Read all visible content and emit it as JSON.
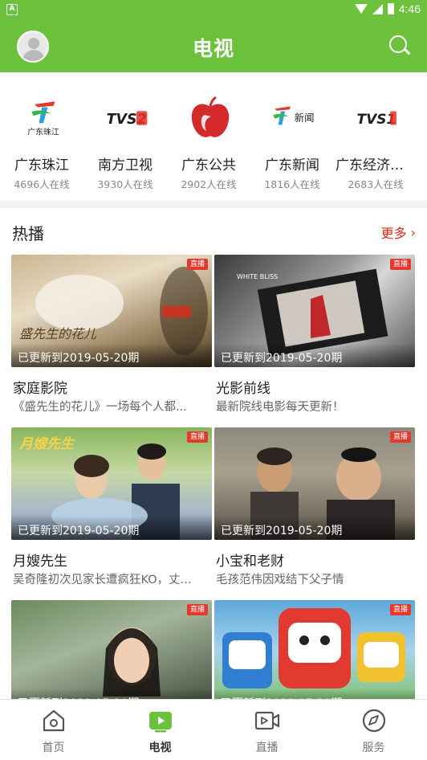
{
  "status_bar": {
    "time": "4:46",
    "left_icon": "A"
  },
  "header": {
    "title": "电视"
  },
  "channels": [
    {
      "name": "广东珠江",
      "viewers": "4696人在线",
      "logo_text": "广东珠江"
    },
    {
      "name": "南方卫视",
      "viewers": "3930人在线",
      "logo_text": "TVS2"
    },
    {
      "name": "广东公共",
      "viewers": "2902人在线",
      "logo_text": ""
    },
    {
      "name": "广东新闻",
      "viewers": "1816人在线",
      "logo_text": "新闻"
    },
    {
      "name": "广东经济科...",
      "viewers": "2683人在线",
      "logo_text": "TVS1"
    }
  ],
  "section": {
    "title": "热播",
    "more": "更多"
  },
  "programs": [
    {
      "title": "家庭影院",
      "desc": "《盛先生的花儿》一场每个人都...",
      "update": "已更新到2019-05-20期",
      "badge": "直播",
      "poster_text": "盛先生的花儿"
    },
    {
      "title": "光影前线",
      "desc": "最新院线电影每天更新！",
      "update": "已更新到2019-05-20期",
      "badge": "直播",
      "poster_text": "WHITE BLISS"
    },
    {
      "title": "月嫂先生",
      "desc": "吴奇隆初次见家长遭疯狂KO，丈...",
      "update": "已更新到2019-05-20期",
      "badge": "直播",
      "poster_text": "月嫂先生"
    },
    {
      "title": "小宝和老财",
      "desc": "毛孩范伟因戏结下父子情",
      "update": "已更新到2019-05-20期",
      "badge": "直播",
      "poster_text": ""
    },
    {
      "title": "",
      "desc": "",
      "update": "已更新到2019-05-20期",
      "badge": "直播",
      "poster_text": ""
    },
    {
      "title": "",
      "desc": "",
      "update": "已更新到2019-05-20期",
      "badge": "直播",
      "poster_text": ""
    }
  ],
  "bottom_nav": [
    {
      "label": "首页",
      "icon": "home-icon",
      "active": false
    },
    {
      "label": "电视",
      "icon": "tv-icon",
      "active": true
    },
    {
      "label": "直播",
      "icon": "live-icon",
      "active": false
    },
    {
      "label": "服务",
      "icon": "compass-icon",
      "active": false
    }
  ],
  "colors": {
    "brand": "#6cc23d",
    "accent": "#e0281e",
    "badge": "#e33a2e"
  }
}
